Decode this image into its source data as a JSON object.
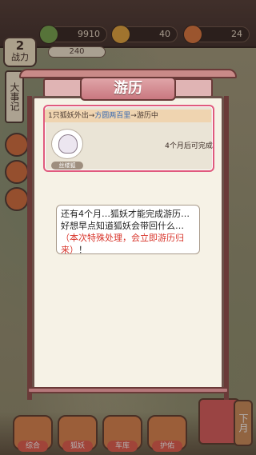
{
  "resources": {
    "jade": "9910",
    "gold": "40",
    "food": "24"
  },
  "level": {
    "value": "2",
    "label": "战力"
  },
  "power": "240",
  "side": {
    "events_label": "大事记"
  },
  "dialog": {
    "title": "游历",
    "travel": {
      "prefix": "1只狐妖外出→",
      "destination": "方圆两百里",
      "suffix": "→游历中",
      "fox_name": "丝缕狐",
      "status": "4个月后可完成"
    },
    "message": {
      "text": "还有4个月…狐妖才能完成游历…好想早点知道狐妖会带回什么…",
      "special": "（本次特殊处理，会立即游历归来）",
      "end": "！"
    }
  },
  "nav": [
    "综合",
    "狐妖",
    "车库",
    "护佑"
  ],
  "month_label": "下月",
  "colors": {
    "accent_pink": "#e05a7e",
    "frame": "#6a3a38",
    "panel": "#f6f2e6"
  }
}
